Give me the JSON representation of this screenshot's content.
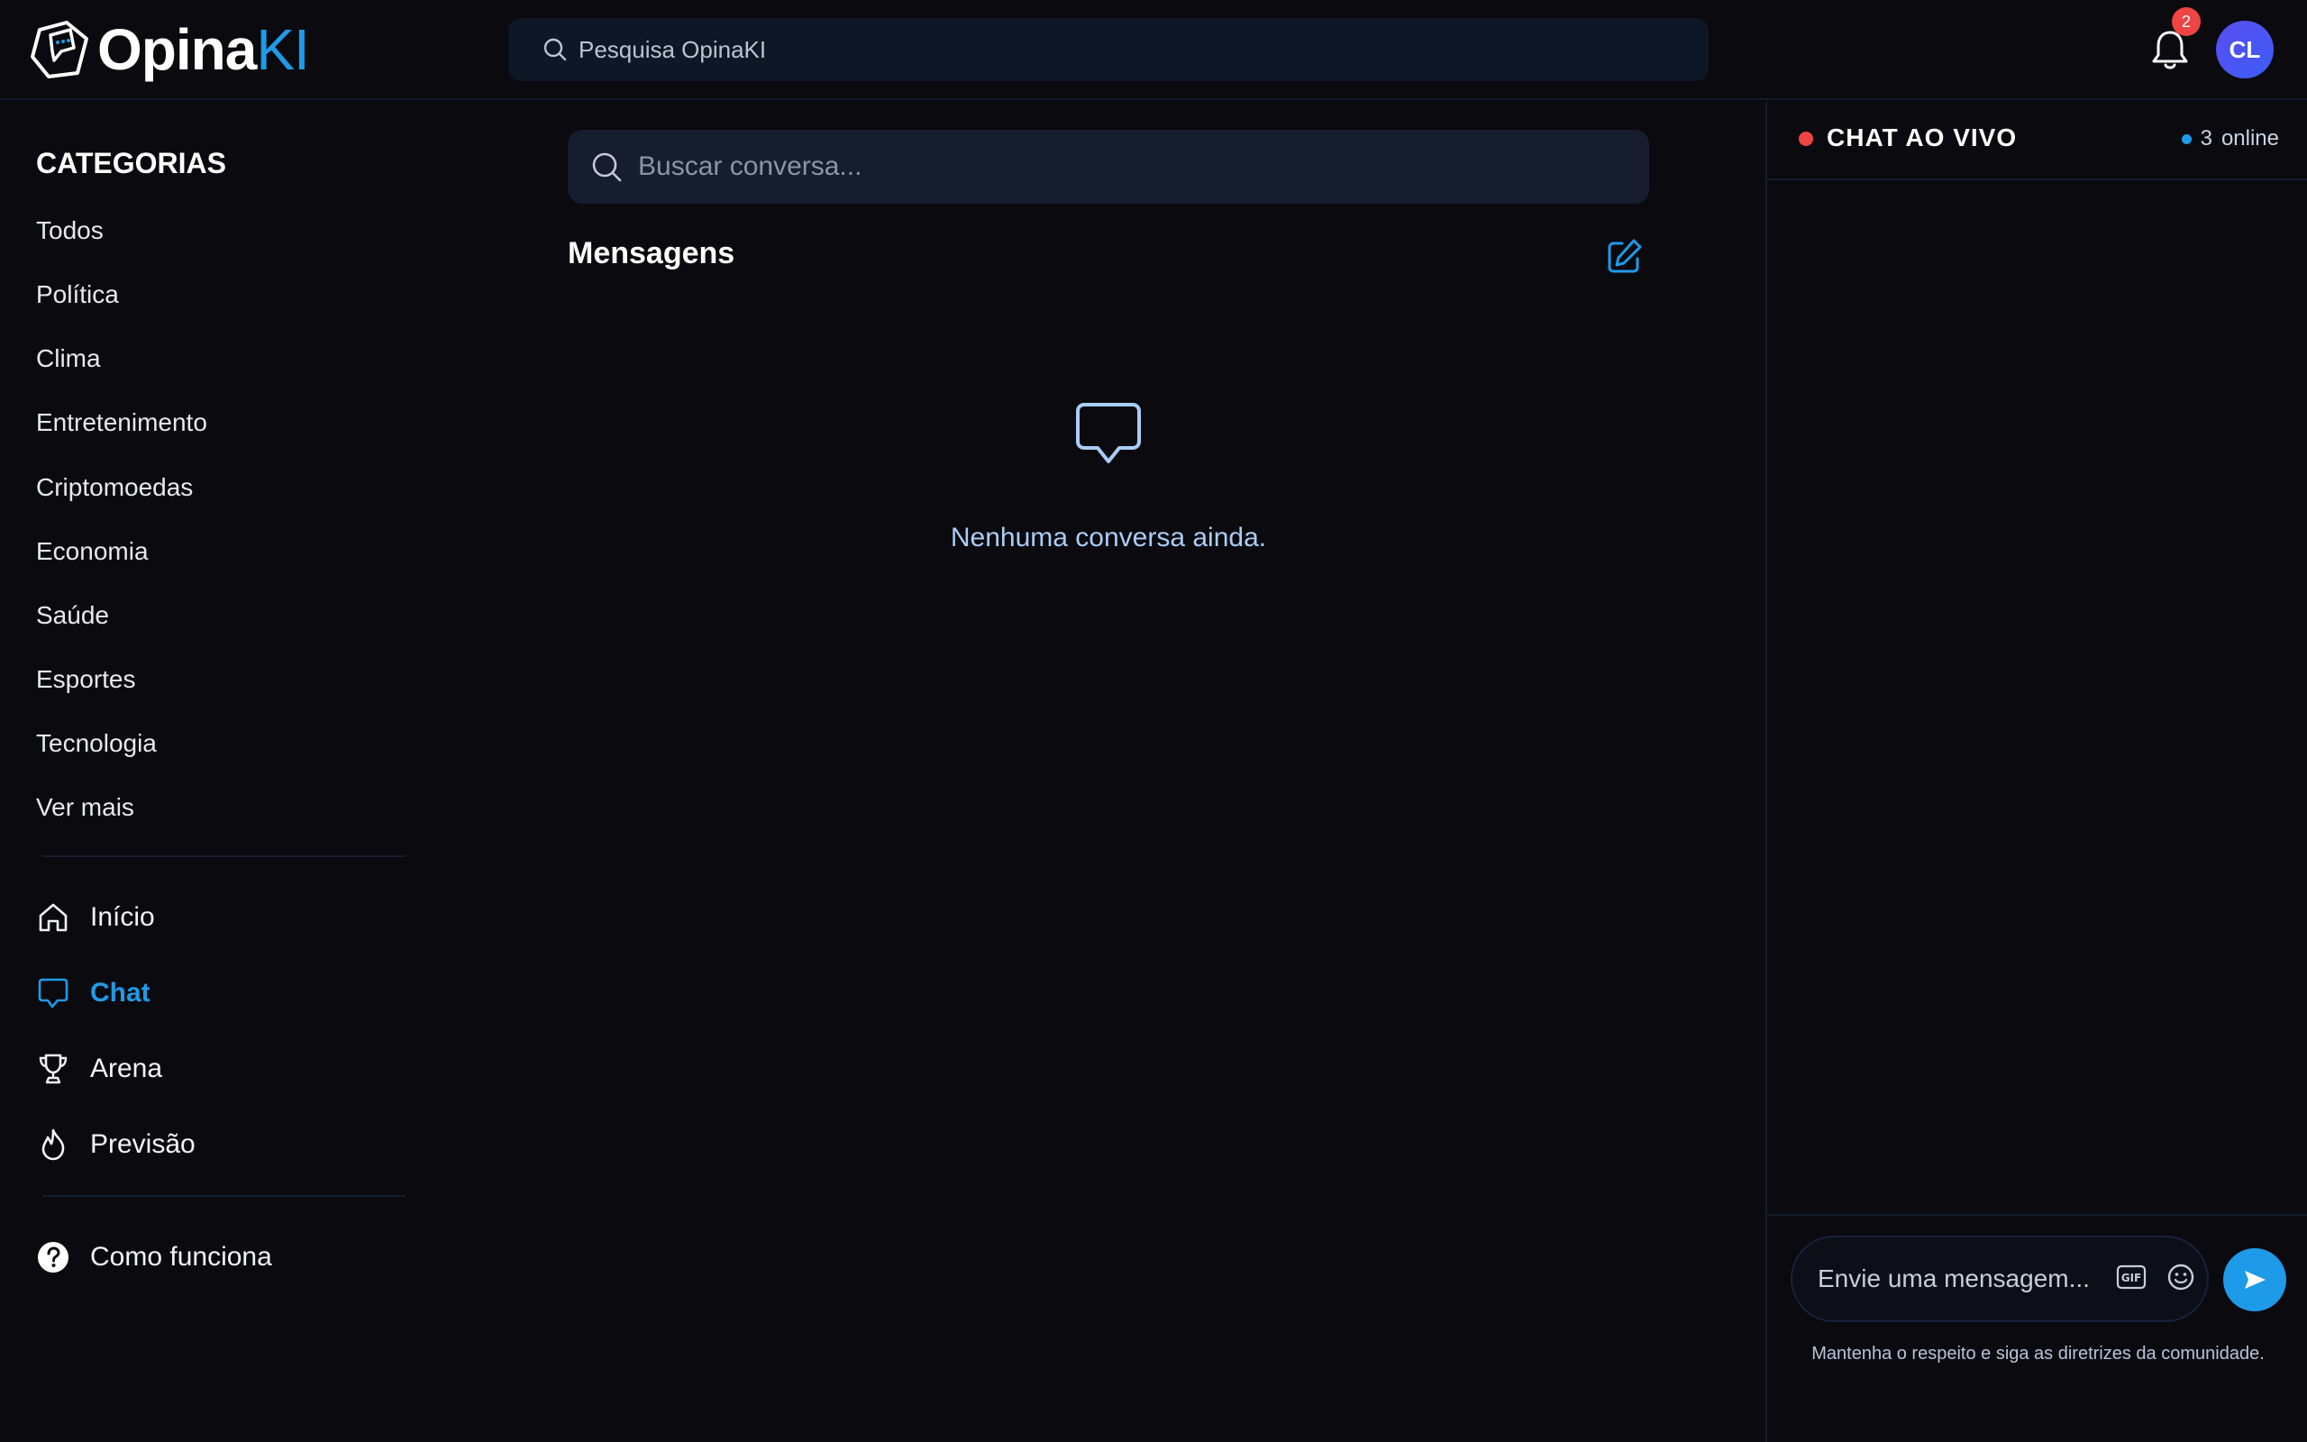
{
  "header": {
    "logo_main": "Opina",
    "logo_accent": "KI",
    "search_placeholder": "Pesquisa OpinaKI",
    "notification_count": "2",
    "avatar_initials": "CL"
  },
  "sidebar": {
    "categories_title": "CATEGORIAS",
    "categories": [
      "Todos",
      "Política",
      "Clima",
      "Entretenimento",
      "Criptomoedas",
      "Economia",
      "Saúde",
      "Esportes",
      "Tecnologia",
      "Ver mais"
    ],
    "nav": [
      {
        "label": "Início",
        "icon": "home-icon"
      },
      {
        "label": "Chat",
        "icon": "chat-icon",
        "active": true
      },
      {
        "label": "Arena",
        "icon": "trophy-icon"
      },
      {
        "label": "Previsão",
        "icon": "flame-icon"
      }
    ],
    "help": {
      "label": "Como funciona",
      "icon": "help-icon"
    }
  },
  "main": {
    "search_placeholder": "Buscar conversa...",
    "title": "Mensagens",
    "empty_text": "Nenhuma conversa ainda."
  },
  "chat": {
    "title": "CHAT AO VIVO",
    "online_count": "3",
    "online_label": "online",
    "input_placeholder": "Envie uma mensagem...",
    "guidelines": "Mantenha o respeito e siga as diretrizes da comunidade."
  },
  "colors": {
    "background": "#0a0a0f",
    "accent": "#1e9be8",
    "live": "#ef4444",
    "panel": "#161d2f"
  }
}
